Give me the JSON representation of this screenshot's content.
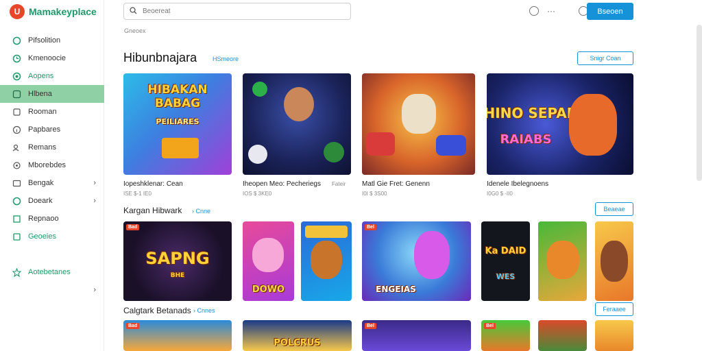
{
  "app": {
    "name": "Mamakeyplace"
  },
  "sidebar": {
    "items": [
      {
        "label": "Pifsolition",
        "icon": "refresh-icon"
      },
      {
        "label": "Kmenoocie",
        "icon": "clock-icon"
      },
      {
        "label": "Aopens",
        "icon": "globe-icon"
      },
      {
        "label": "Hlbena",
        "icon": "user-icon",
        "active": true
      },
      {
        "label": "Rooman",
        "icon": "square-icon"
      },
      {
        "label": "Papbares",
        "icon": "info-icon"
      },
      {
        "label": "Remans",
        "icon": "people-icon"
      },
      {
        "label": "Mborebdes",
        "icon": "settings-icon"
      },
      {
        "label": "Bengak",
        "icon": "image-icon",
        "chevron": true
      },
      {
        "label": "Doeark",
        "icon": "globe-icon",
        "chevron": true
      },
      {
        "label": "Repnaoo",
        "icon": "square-icon"
      },
      {
        "label": "Geoeies",
        "icon": "book-icon"
      }
    ],
    "bottom": {
      "label": "Aotebetanes",
      "icon": "star-icon"
    }
  },
  "search": {
    "placeholder": "Beoereat"
  },
  "header": {
    "primary_button": "Bseoen",
    "dots": "···"
  },
  "breadcrumb": "Gneoex",
  "sections": [
    {
      "title": "Hibunbnajara",
      "link": "HSmeore",
      "button": "Snigr Coan",
      "cards": [
        {
          "title": "Iopeshklenar: Cean",
          "meta": "ISE $-1 IE0",
          "tag": "",
          "art_text": "HIBAKAN BABAG",
          "art_sub": "PEILIARES"
        },
        {
          "title": "Iheopen Meo: Pecheriegs",
          "meta": "IOS $ 3KE0",
          "tag": "Fateir",
          "art_text": "",
          "art_sub": ""
        },
        {
          "title": "Matl Gie Fret: Genenn",
          "meta": "I0I $ 3S00",
          "tag": "",
          "art_text": "",
          "art_sub": ""
        },
        {
          "title": "Idenele Ibelegnoens",
          "meta": "I0G0 $ -II0",
          "tag": "",
          "art_text": "THINO SEPAR",
          "art_sub": "RAIABS"
        }
      ]
    },
    {
      "title": "Kargan Hibwark",
      "link": "Cnne",
      "button": "Beaeae",
      "cards": [
        {
          "badge": "Bad",
          "art_text": "SAPNG",
          "art_sub": "BHE"
        },
        {
          "badge": "",
          "art_text": "DOWO",
          "art_sub": ""
        },
        {
          "badge": "",
          "art_text": "",
          "art_sub": ""
        },
        {
          "badge": "Bel",
          "art_text": "ENGEIAS",
          "art_sub": ""
        },
        {
          "badge": "",
          "art_text": "Ka DAID",
          "art_sub": "WES"
        },
        {
          "badge": "",
          "art_text": "",
          "art_sub": ""
        },
        {
          "badge": "",
          "art_text": "",
          "art_sub": ""
        }
      ]
    },
    {
      "title": "Calgtark Betanads",
      "link": "Cnnes",
      "button": "Feraaee",
      "cards": [
        {
          "badge": "Bad",
          "art_text": "",
          "art_sub": ""
        },
        {
          "badge": "",
          "art_text": "POLCRUS",
          "art_sub": ""
        },
        {
          "badge": "Bel",
          "art_text": "",
          "art_sub": ""
        },
        {
          "badge": "Bel",
          "art_text": "",
          "art_sub": ""
        },
        {
          "badge": "",
          "art_text": "",
          "art_sub": ""
        },
        {
          "badge": "",
          "art_text": "",
          "art_sub": ""
        }
      ]
    }
  ],
  "colors": {
    "accent": "#1592d8",
    "brand": "#1e9a6a",
    "active_nav": "#8fd1a5",
    "logo": "#e8462b"
  }
}
